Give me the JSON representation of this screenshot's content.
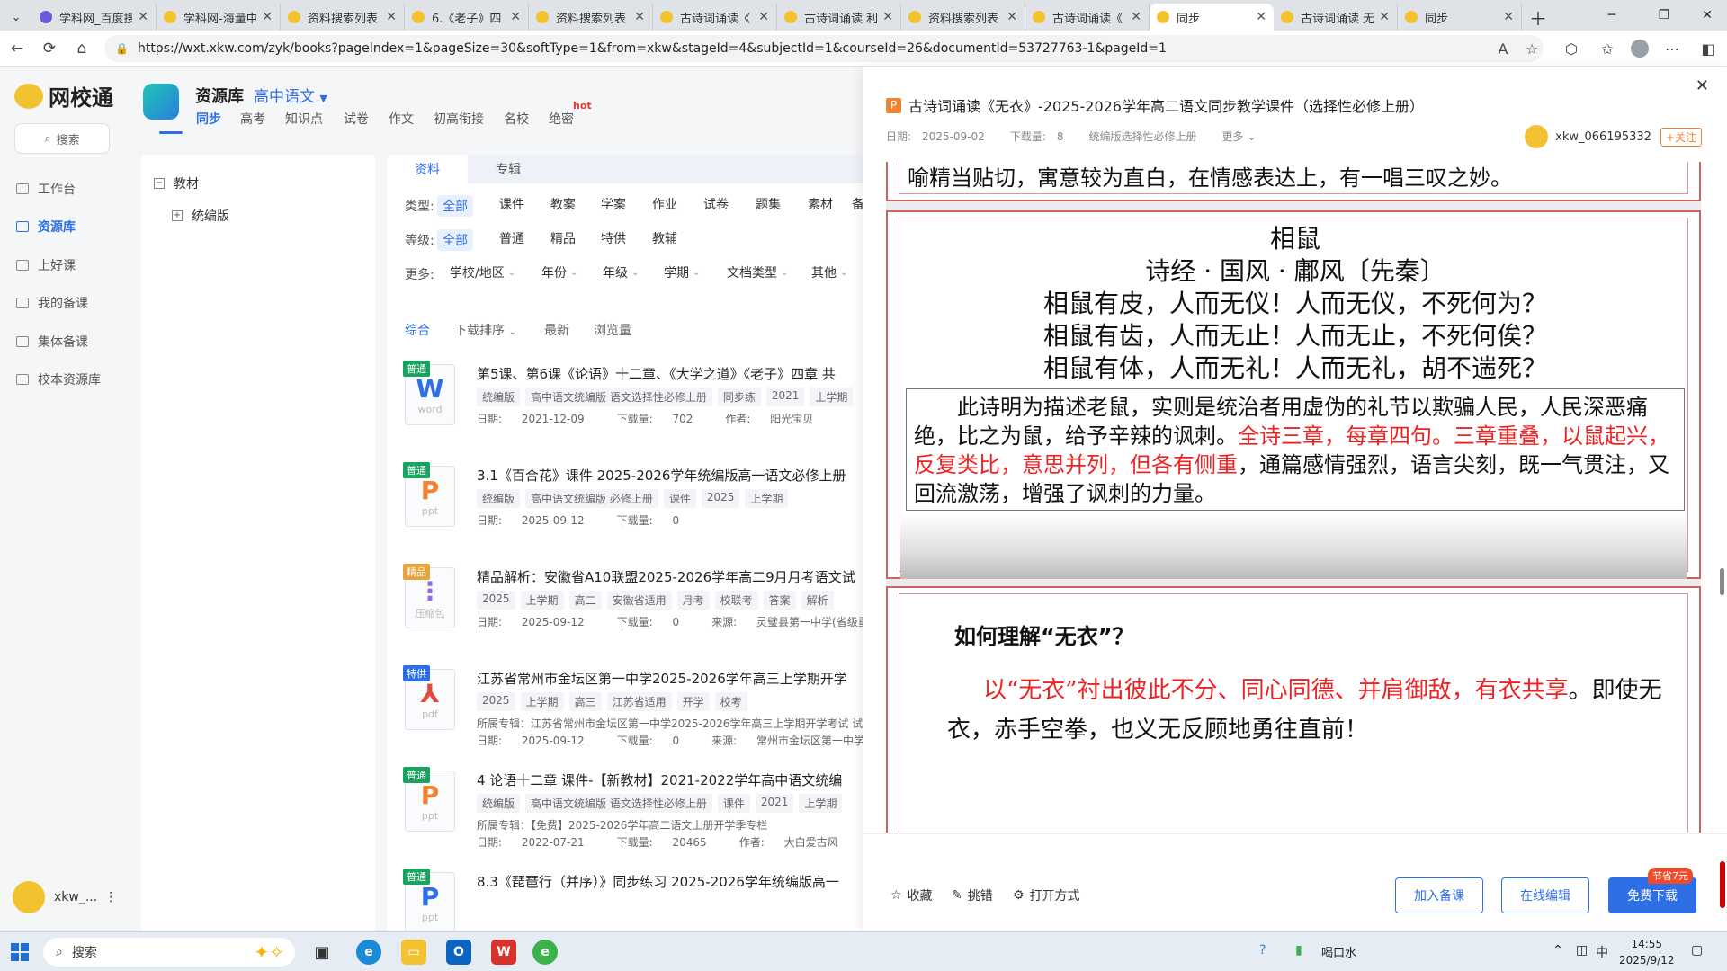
{
  "browser": {
    "tabs": [
      {
        "title": "学科网_百度搜",
        "icon": "paw-icon"
      },
      {
        "title": "学科网-海量中",
        "icon": "owl-icon"
      },
      {
        "title": "资料搜索列表",
        "icon": "owl-icon"
      },
      {
        "title": "6.《老子》四",
        "icon": "owl-icon"
      },
      {
        "title": "资料搜索列表",
        "icon": "owl-icon"
      },
      {
        "title": "古诗词诵读《",
        "icon": "owl-icon"
      },
      {
        "title": "古诗词诵读 利",
        "icon": "owl-icon"
      },
      {
        "title": "资料搜索列表",
        "icon": "owl-icon"
      },
      {
        "title": "古诗词诵读《",
        "icon": "owl-icon"
      },
      {
        "title": "同步",
        "icon": "owl-icon"
      },
      {
        "title": "古诗词诵读 无",
        "icon": "owl-icon"
      },
      {
        "title": "同步",
        "icon": "owl-icon"
      }
    ],
    "url": "https://wxt.xkw.com/zyk/books?pageIndex=1&pageSize=30&softType=1&from=xkw&stageId=4&subjectId=1&courseId=26&documentId=53727763-1&pageId=1"
  },
  "leftnav": {
    "logo": "网校通",
    "search": "搜索",
    "items": [
      "工作台",
      "资源库",
      "上好课",
      "我的备课",
      "集体备课",
      "校本资源库"
    ],
    "user": "xkw_..."
  },
  "header": {
    "title": "资源库",
    "subject": "高中语文",
    "tabs": [
      "同步",
      "高考",
      "知识点",
      "试卷",
      "作文",
      "初高衔接",
      "名校",
      "绝密"
    ],
    "hot": "hot"
  },
  "tree": {
    "root": "教材",
    "child": "统编版"
  },
  "list": {
    "tabs": [
      "资料",
      "专辑"
    ],
    "filters": {
      "type_label": "类型:",
      "types": [
        "全部",
        "课件",
        "教案",
        "学案",
        "作业",
        "试卷",
        "题集",
        "素材",
        "备"
      ],
      "level_label": "等级:",
      "levels": [
        "全部",
        "普通",
        "精品",
        "特供",
        "教辅"
      ],
      "more_label": "更多:",
      "more": [
        "学校/地区",
        "年份",
        "年级",
        "学期",
        "文档类型",
        "其他"
      ]
    },
    "sort": [
      "综合",
      "下载排序",
      "最新",
      "浏览量"
    ],
    "items": [
      {
        "badge": "普通",
        "badge_color": "#1aa260",
        "filetype": "W",
        "ext": "word",
        "icon_color": "#2f6fe6",
        "title": "第5课、第6课《论语》十二章、《大学之道》《老子》四章 共",
        "tags": [
          "统编版",
          "高中语文统编版 语文选择性必修上册",
          "同步练",
          "2021",
          "上学期"
        ],
        "line2": "",
        "date_label": "日期:",
        "date": "2021-12-09",
        "dl_label": "下载量:",
        "dl": "702",
        "extra_label": "作者:",
        "extra": "阳光宝贝"
      },
      {
        "badge": "普通",
        "badge_color": "#1aa260",
        "filetype": "P",
        "ext": "ppt",
        "icon_color": "#f08232",
        "title": "3.1《百合花》课件 2025-2026学年统编版高一语文必修上册",
        "tags": [
          "统编版",
          "高中语文统编版 必修上册",
          "课件",
          "2025",
          "上学期"
        ],
        "line2": "",
        "date_label": "日期:",
        "date": "2025-09-12",
        "dl_label": "下载量:",
        "dl": "0",
        "extra_label": "",
        "extra": ""
      },
      {
        "badge": "精品",
        "badge_color": "#e8a23a",
        "filetype": "⋮",
        "ext": "压缩包",
        "icon_color": "#8a6de0",
        "title": "精品解析：安徽省A10联盟2025-2026学年高二9月月考语文试",
        "tags": [
          "2025",
          "上学期",
          "高二",
          "安徽省适用",
          "月考",
          "校联考",
          "答案",
          "解析"
        ],
        "line2": "",
        "date_label": "日期:",
        "date": "2025-09-12",
        "dl_label": "下载量:",
        "dl": "0",
        "extra_label": "来源:",
        "extra": "灵璧县第一中学(省级重点)"
      },
      {
        "badge": "特供",
        "badge_color": "#2f6fe6",
        "filetype": "⅄",
        "ext": "pdf",
        "icon_color": "#e04a3a",
        "title": "江苏省常州市金坛区第一中学2025-2026学年高三上学期开学",
        "tags": [
          "2025",
          "上学期",
          "高三",
          "江苏省适用",
          "开学",
          "校考"
        ],
        "line2": "所属专辑：江苏省常州市金坛区第一中学2025-2026学年高三上学期开学考试 试题",
        "date_label": "日期:",
        "date": "2025-09-12",
        "dl_label": "下载量:",
        "dl": "0",
        "extra_label": "来源:",
        "extra": "常州市金坛区第一中学(省级重点"
      },
      {
        "badge": "普通",
        "badge_color": "#1aa260",
        "filetype": "P",
        "ext": "ppt",
        "icon_color": "#f08232",
        "title": "4 论语十二章 课件-【新教材】2021-2022学年高中语文统编",
        "tags": [
          "统编版",
          "高中语文统编版 语文选择性必修上册",
          "课件",
          "2021",
          "上学期"
        ],
        "line2": "所属专辑：【免费】2025-2026学年高二语文上册开学季专栏",
        "date_label": "日期:",
        "date": "2022-07-21",
        "dl_label": "下载量:",
        "dl": "20465",
        "extra_label": "作者:",
        "extra": "大白爱古风"
      },
      {
        "badge": "普通",
        "badge_color": "#1aa260",
        "filetype": "P",
        "ext": "ppt",
        "icon_color": "#2f6fe6",
        "title": "8.3《琵琶行（并序）》同步练习 2025-2026学年统编版高一",
        "tags": [],
        "line2": "",
        "date_label": "",
        "date": "",
        "dl_label": "",
        "dl": "",
        "extra_label": "",
        "extra": ""
      }
    ]
  },
  "preview": {
    "title": "古诗词诵读《无衣》-2025-2026学年高二语文同步教学课件（选择性必修上册）",
    "date": "日期:　2025-09-02",
    "downloads": "下载量:　8",
    "edition": "统编版选择性必修上册",
    "more": "更多",
    "author": "xkw_066195332",
    "follow": "+关注",
    "slide_top_text": "喻精当贴切，寓意较为直白，在情感表达上，有一唱三叹之妙。",
    "poem": {
      "title": "相鼠",
      "source": "诗经 · 国风 · 鄘风〔先秦〕",
      "lines": [
        "相鼠有皮，人而无仪！人而无仪，不死何为？",
        "相鼠有齿，人而无止！人而无止，不死何俟？",
        "相鼠有体，人而无礼！人而无礼，胡不遄死？"
      ]
    },
    "explain": {
      "p1": "此诗明为描述老鼠，实则是统治者用虚伪的礼节以欺骗人民，人民深恶痛绝，比之为鼠，给予辛辣的讽刺。",
      "red": "全诗三章，每章四句。三章重叠，以鼠起兴，反复类比，意思并列，但各有侧重",
      "p2": "，通篇感情强烈，语言尖刻，既一气贯注，又回流激荡，增强了讽刺的力量。"
    },
    "question": "如何理解“无衣”？",
    "answer": {
      "red": "以“无衣”衬出彼此不分、同心同德、并肩御敌，有衣共享",
      "black": "。即使无衣，赤手空拳，也义无反顾地勇往直前！"
    },
    "actions": {
      "fav": "收藏",
      "report": "挑错",
      "open": "打开方式"
    },
    "buttons": {
      "add": "加入备课",
      "edit": "在线编辑",
      "download": "免费下载",
      "save": "节省7元"
    }
  },
  "taskbar": {
    "search": "搜索",
    "tray_text": "喝口水",
    "ime": "中",
    "time": "14:55",
    "date": "2025/9/12"
  }
}
